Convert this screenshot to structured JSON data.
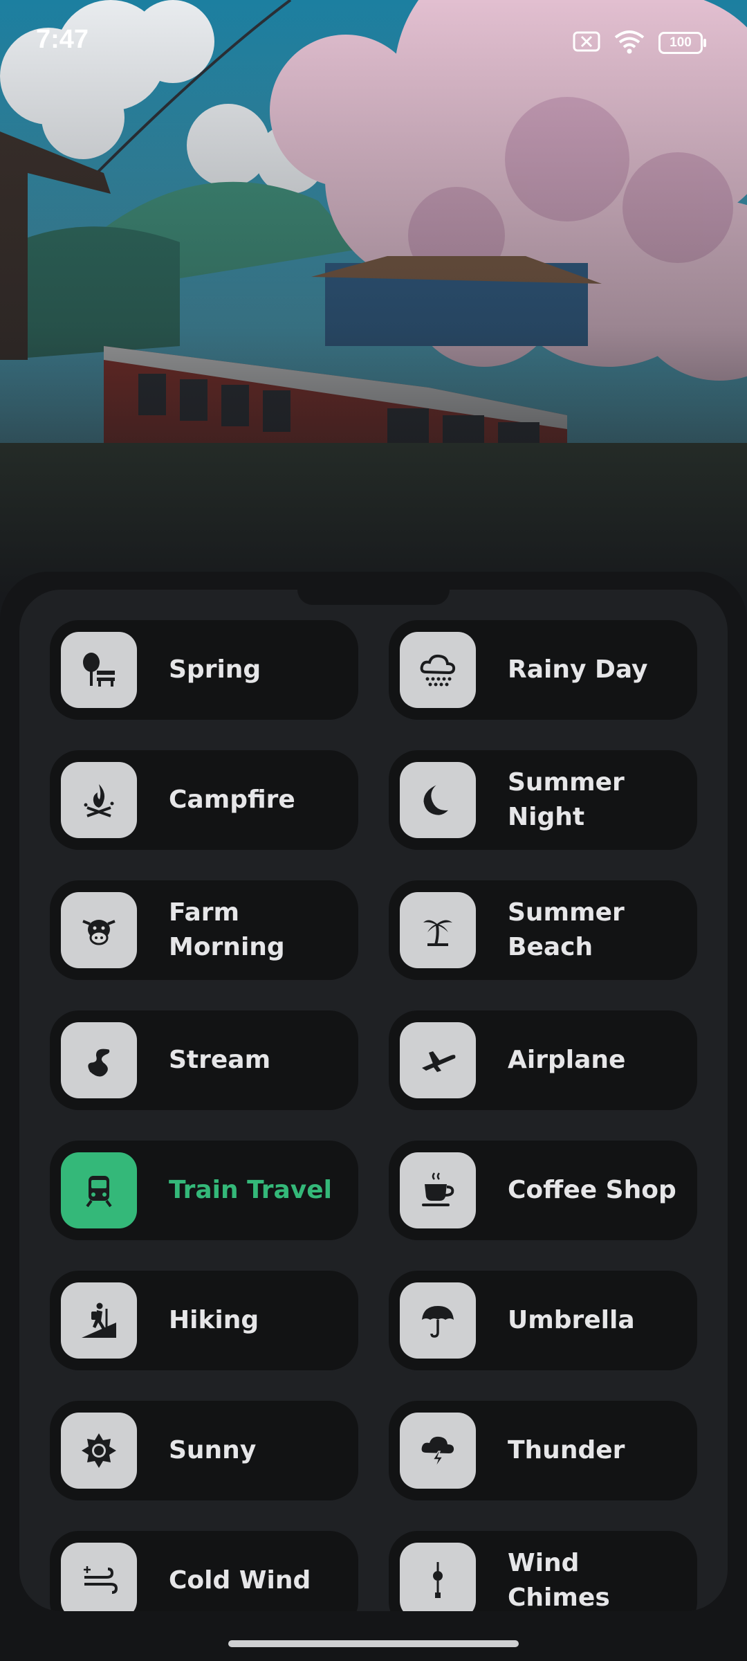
{
  "status_bar": {
    "time": "7:47",
    "battery": "100",
    "icons": [
      "sim-x-icon",
      "wifi-icon",
      "battery-icon"
    ]
  },
  "colors": {
    "active": "#34b879",
    "card_bg": "#121314",
    "sheet_bg": "#1f2124",
    "icon_tile": "#cfd0d2"
  },
  "sounds": [
    {
      "label": "Spring",
      "icon": "park-bench-icon",
      "active": false
    },
    {
      "label": "Rainy Day",
      "icon": "rain-cloud-icon",
      "active": false
    },
    {
      "label": "Campfire",
      "icon": "campfire-icon",
      "active": false
    },
    {
      "label": "Summer Night",
      "icon": "moon-icon",
      "active": false
    },
    {
      "label": "Farm Morning",
      "icon": "cow-icon",
      "active": false
    },
    {
      "label": "Summer Beach",
      "icon": "palm-tree-icon",
      "active": false
    },
    {
      "label": "Stream",
      "icon": "stream-icon",
      "active": false
    },
    {
      "label": "Airplane",
      "icon": "airplane-icon",
      "active": false
    },
    {
      "label": "Train Travel",
      "icon": "train-icon",
      "active": true
    },
    {
      "label": "Coffee Shop",
      "icon": "coffee-cup-icon",
      "active": false
    },
    {
      "label": "Hiking",
      "icon": "hiker-icon",
      "active": false
    },
    {
      "label": "Umbrella",
      "icon": "umbrella-icon",
      "active": false
    },
    {
      "label": "Sunny",
      "icon": "sun-icon",
      "active": false
    },
    {
      "label": "Thunder",
      "icon": "thunder-cloud-icon",
      "active": false
    },
    {
      "label": "Cold Wind",
      "icon": "wind-icon",
      "active": false
    },
    {
      "label": "Wind Chimes",
      "icon": "wind-chimes-icon",
      "active": false
    }
  ]
}
